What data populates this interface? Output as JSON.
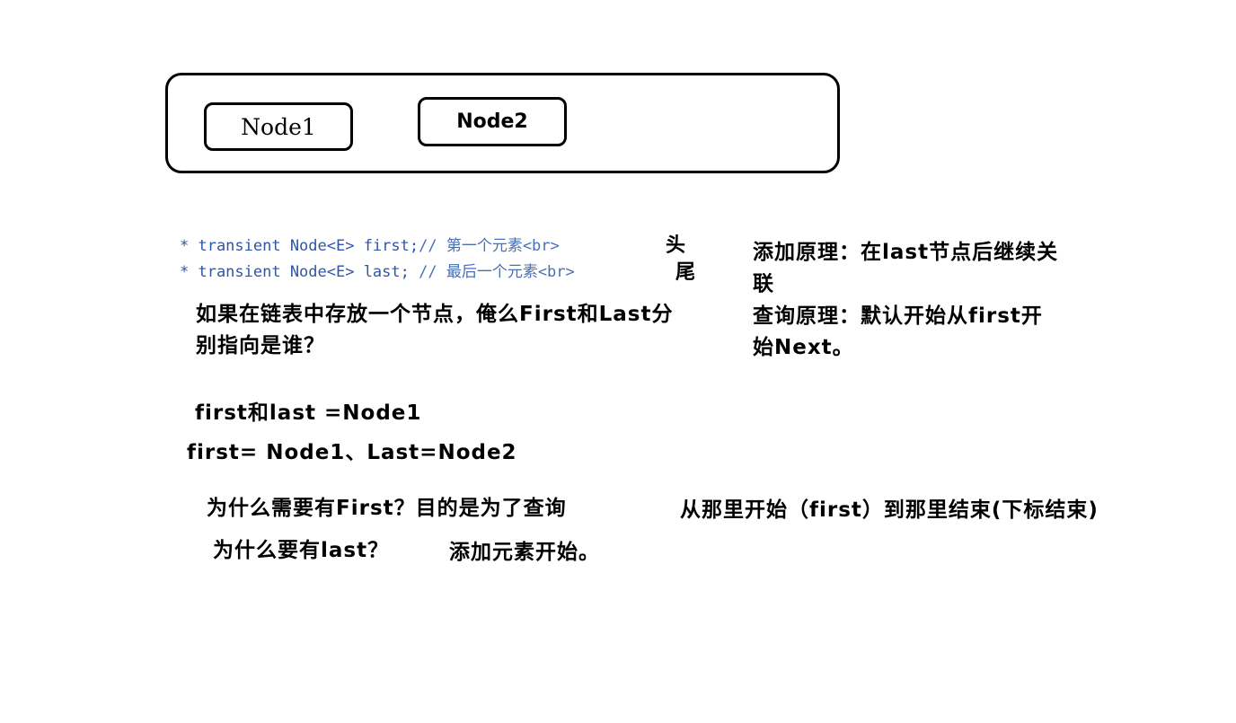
{
  "diagram": {
    "node1_label": "Node1",
    "node2_label": "Node2"
  },
  "code": {
    "line1_code": "* transient Node<E> first;",
    "line1_comment": "// 第一个元素<br>",
    "line2_code": "* transient Node<E> last; ",
    "line2_comment": "// 最后一个元素<br>"
  },
  "annotations": {
    "head": "头",
    "tail": "尾"
  },
  "principles": {
    "add_line1": "添加原理：在last节点后继续关",
    "add_line2": "联",
    "query_line1": "查询原理：默认开始从first开",
    "query_line2": "始Next。"
  },
  "question": {
    "line1": "如果在链表中存放一个节点，俺么First和Last分",
    "line2": "别指向是谁？"
  },
  "answers": {
    "single": "first和last =Node1",
    "double": "first= Node1、Last=Node2"
  },
  "why_first": {
    "question": "为什么需要有First？目的是为了查询",
    "answer": "从那里开始（first）到那里结束(下标结束)"
  },
  "why_last": {
    "question": "为什么要有last？",
    "answer": "添加元素开始。"
  }
}
